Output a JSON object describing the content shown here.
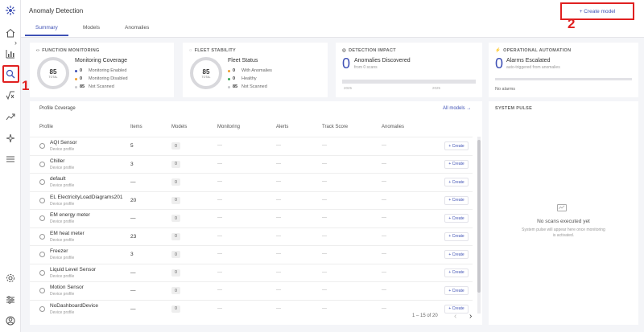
{
  "app": {
    "title": "Anomaly Detection",
    "accent": "#3f51b5",
    "highlight": "#e02020"
  },
  "sidebar": {
    "icons": [
      "logo-icon",
      "home-icon",
      "chart-icon",
      "anomaly-search-icon",
      "formula-icon",
      "trend-icon",
      "sparkle-icon",
      "menu-icon",
      "settings-icon",
      "sliders-icon",
      "account-icon"
    ],
    "collapse_glyph": "›"
  },
  "markers": {
    "one": "1",
    "two": "2"
  },
  "tabs": [
    "Summary",
    "Models",
    "Anomalies"
  ],
  "header": {
    "create_label": "+ Create model"
  },
  "cards": {
    "function_monitoring": {
      "title": "FUNCTION MONITORING",
      "donut_value": "85",
      "donut_label": "TOTAL",
      "subtitle": "Monitoring Coverage",
      "legend": [
        {
          "value": "0",
          "label": "Monitoring Enabled",
          "color": "#3f51b5"
        },
        {
          "value": "0",
          "label": "Monitoring Disabled",
          "color": "#f0a030"
        },
        {
          "value": "85",
          "label": "Not Scanned",
          "color": "#c8c8cc"
        }
      ]
    },
    "fleet_stability": {
      "title": "FLEET STABILITY",
      "donut_value": "85",
      "donut_label": "TOTAL",
      "subtitle": "Fleet Status",
      "legend": [
        {
          "value": "0",
          "label": "With Anomalies",
          "color": "#f0a030"
        },
        {
          "value": "0",
          "label": "Healthy",
          "color": "#3aa757"
        },
        {
          "value": "85",
          "label": "Not Scanned",
          "color": "#c8c8cc"
        }
      ]
    },
    "detection_impact": {
      "title": "DETECTION IMPACT",
      "value": "0",
      "subtitle": "Anomalies Discovered",
      "note": "from 0 scans",
      "axis_left": "2025",
      "axis_right": "2025"
    },
    "operational_automation": {
      "title": "OPERATIONAL AUTOMATION",
      "value": "0",
      "subtitle": "Alarms Escalated",
      "note": "auto-triggered from anomalies",
      "footer": "No alarms"
    }
  },
  "table": {
    "title": "Profile Coverage",
    "all_models": "All models →",
    "headers": [
      "Profile",
      "Items",
      "Models",
      "Monitoring",
      "Alerts",
      "Track Score",
      "Anomalies"
    ],
    "rows": [
      {
        "name": "AQI Sensor",
        "sub": "Device profile",
        "items": "5",
        "models": "0",
        "monitoring": "—",
        "alerts": "—",
        "track": "—",
        "anomalies": "—",
        "action": "+ Create"
      },
      {
        "name": "Chiller",
        "sub": "Device profile",
        "items": "3",
        "models": "0",
        "monitoring": "—",
        "alerts": "—",
        "track": "—",
        "anomalies": "—",
        "action": "+ Create"
      },
      {
        "name": "default",
        "sub": "Device profile",
        "items": "—",
        "models": "0",
        "monitoring": "—",
        "alerts": "—",
        "track": "—",
        "anomalies": "—",
        "action": "+ Create"
      },
      {
        "name": "EL ElectricityLoadDiagrams201",
        "sub": "Device profile",
        "items": "20",
        "models": "0",
        "monitoring": "—",
        "alerts": "—",
        "track": "—",
        "anomalies": "—",
        "action": "+ Create"
      },
      {
        "name": "EM energy meter",
        "sub": "Device profile",
        "items": "—",
        "models": "0",
        "monitoring": "—",
        "alerts": "—",
        "track": "—",
        "anomalies": "—",
        "action": "+ Create"
      },
      {
        "name": "EM heat meter",
        "sub": "Device profile",
        "items": "23",
        "models": "0",
        "monitoring": "—",
        "alerts": "—",
        "track": "—",
        "anomalies": "—",
        "action": "+ Create"
      },
      {
        "name": "Freezer",
        "sub": "Device profile",
        "items": "3",
        "models": "0",
        "monitoring": "—",
        "alerts": "—",
        "track": "—",
        "anomalies": "—",
        "action": "+ Create"
      },
      {
        "name": "Liquid Level Sensor",
        "sub": "Device profile",
        "items": "—",
        "models": "0",
        "monitoring": "—",
        "alerts": "—",
        "track": "—",
        "anomalies": "—",
        "action": "+ Create"
      },
      {
        "name": "Motion Sensor",
        "sub": "Device profile",
        "items": "—",
        "models": "0",
        "monitoring": "—",
        "alerts": "—",
        "track": "—",
        "anomalies": "—",
        "action": "+ Create"
      },
      {
        "name": "NoDashboardDevice",
        "sub": "Device profile",
        "items": "—",
        "models": "0",
        "monitoring": "—",
        "alerts": "—",
        "track": "—",
        "anomalies": "—",
        "action": "+ Create"
      }
    ],
    "pagination": "1 – 15 of 20",
    "prev_glyph": "‹",
    "next_glyph": "›"
  },
  "pulse": {
    "title": "SYSTEM PULSE",
    "empty_title": "No scans executed yet",
    "empty_text": "System pulse will appear here once monitoring is activated."
  }
}
